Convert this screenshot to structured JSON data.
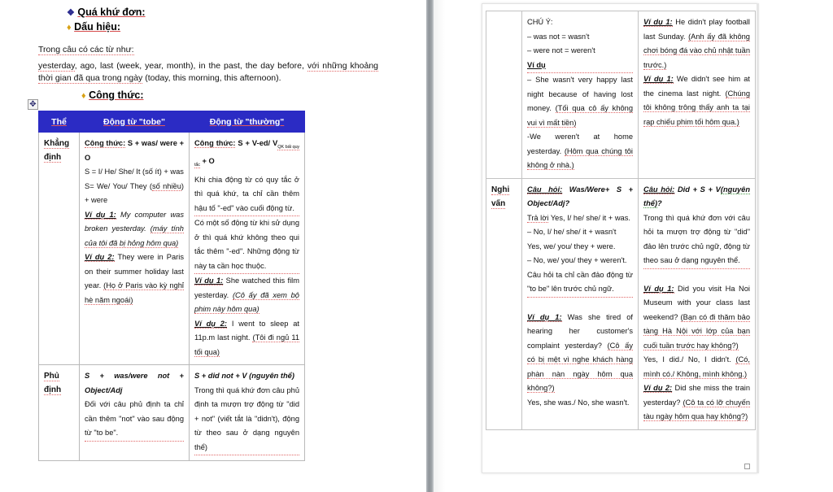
{
  "document": {
    "headings": {
      "h1": {
        "glyph": "❖",
        "text": "Quá khứ đơn:"
      },
      "h2": {
        "glyph": "♦",
        "text": "Dấu hiệu:"
      },
      "h3": {
        "glyph": "♦",
        "text": "Công thức:"
      }
    },
    "intro": {
      "line1": "Trong câu có các từ như:",
      "line2_a": "yesterday",
      "line2_b": ", ago, last (week, year, month), in the past, the day before, ",
      "line2_c": "với những khoảng thời gian đã qua trong ngày",
      "line2_d": " (today, this morning, this afternoon)."
    },
    "table_handle_icon": "move-handle-icon"
  },
  "left_table": {
    "headers": [
      "Thể",
      "Động từ \"tobe\"",
      "Động từ \"thường\""
    ],
    "rows": [
      {
        "label": "Khẳng định",
        "tobe": {
          "formula_label": "Công thức:",
          "formula": " S  + was/ were + O",
          "lines": [
            "S = I/ He/ She/ It (số ít) + was",
            "S= We/ You/ They (số nhiều) + were"
          ],
          "examples": [
            {
              "label": "Ví dụ 1:",
              "en": "My computer was broken yesterday.",
              "vi": "(máy tính của tôi đã bị hỏng hôm qua)"
            },
            {
              "label": "Ví dụ 2:",
              "en": "They were in Paris on their summer holiday last year.",
              "vi": "(Họ ở Paris vào kỳ nghỉ hè năm ngoái)"
            }
          ]
        },
        "thuong": {
          "formula_label": "Công thức:",
          "formula": " S + V-ed/ V",
          "formula_sub": "QK bất quy tắc",
          "formula_tail": " + O",
          "lines": [
            "Khi chia động từ có quy tắc ở thì quá khứ, ta chỉ cần thêm hậu tố \"-ed\" vào cuối động từ.",
            "Có một số động từ khi sử dụng ở thì quá khứ không theo qui tắc thêm \"-ed\". Những động từ này ta cần học thuộc."
          ],
          "examples": [
            {
              "label": "Ví dụ 1:",
              "en": "She watched this film yesterday.",
              "vi": "(Cô ấy đã xem bộ phim này hôm qua)"
            },
            {
              "label": "Ví dụ 2:",
              "en": "I went to sleep at 11p.m last night.",
              "vi": "(Tôi đi ngủ 11 tối qua)"
            }
          ]
        }
      },
      {
        "label": "Phủ định",
        "tobe": {
          "formula": "S   +   was/were not   +  Object/Adj",
          "lines": [
            "Đối với câu phủ định ta chỉ cần thêm \"not\" vào sau động từ \"to be\"."
          ]
        },
        "thuong": {
          "formula": "S + did not + V (nguyên thể)",
          "lines": [
            "Trong thì quá khứ đơn câu phủ định ta mượn trợ động từ \"did + not\" (viết tắt là \"didn't), động từ theo sau ở dạng nguyên thể)"
          ]
        }
      }
    ]
  },
  "right_table": {
    "rows": [
      {
        "label": "",
        "note": {
          "title": "CHÚ Ý:",
          "bullets": [
            "– was not = wasn't",
            "– were not = weren't"
          ],
          "example_label": "Ví dụ",
          "examples": [
            {
              "en": "– She wasn't very  happy last night because of having lost money.",
              "vi": "(Tối qua cô ấy không vui vì mất tiền)"
            },
            {
              "en": "-We weren't at        home yesterday.",
              "vi": "(Hôm qua chúng tôi không ở nhà.)"
            }
          ]
        },
        "examples_col": [
          {
            "label": "Ví dụ 1:",
            "en": "He didn't play football last Sunday.",
            "vi": "(Anh ấy đã không chơi bóng đá vào chủ nhật tuần trước.)"
          },
          {
            "label": "Ví dụ 1:",
            "en": "We didn't see him at the cinema last night.",
            "vi": "(Chúng tôi không trông thấy anh ta tại rạp chiếu phim tối hôm qua.)"
          }
        ]
      },
      {
        "label": "Nghi vấn",
        "tobe": {
          "question_label": "Câu hỏi:",
          "question": " Was/Were+  S  + Object/Adj?",
          "answer_label": "Trả lời",
          "answers": [
            " Yes, I/ he/ she/ it + was.",
            "– No, I/ he/ she/ it + wasn't",
            "Yes, we/ you/ they + were.",
            "– No, we/ you/ they + weren't."
          ],
          "note": "Câu hỏi ta chỉ cần đảo động từ \"to be\" lên trước chủ ngữ.",
          "examples": [
            {
              "label": "Ví dụ 1:",
              "en": "Was she tired of hearing her customer's complaint yesterday?",
              "vi": "(Cô ấy có bị mệt vì nghe khách hàng phàn nàn ngày hôm qua không?)",
              "answer": "Yes, she was./ No, she wasn't."
            }
          ]
        },
        "thuong": {
          "question_label": "Câu hỏi:",
          "question_b": " Did + S + V",
          "question_green": "(nguyên thể)",
          "question_tail": "?",
          "note": "Trong thì quá khứ đơn với câu hỏi ta mượn trợ động từ \"did\" đảo lên trước chủ ngữ, động từ theo sau ở dạng nguyên thể.",
          "examples": [
            {
              "label": "Ví dụ 1:",
              "en": "Did you visit Ha  Noi Museum with your class last weekend?",
              "vi": "(Bạn có đi thăm bảo tàng Hà Nội với lớp của bạn cuối tuần trước hay không?)",
              "answer_en": "Yes, I did./ No, I didn't.",
              "answer_vi": "(Có, mình có./ Không, mình không.)"
            },
            {
              "label": "Ví dụ 2:",
              "en": "Did she miss the train yesterday?",
              "vi": "(Cô ta có lỡ chuyến tàu ngày hôm qua hay không?)"
            }
          ]
        }
      }
    ]
  },
  "colors": {
    "header_bg": "#2b2bc4",
    "header_text": "#ffffff",
    "spellcheck_underline": "#e06666",
    "grammar_underline": "#4a9b4a",
    "gutter": "#8f9499"
  }
}
